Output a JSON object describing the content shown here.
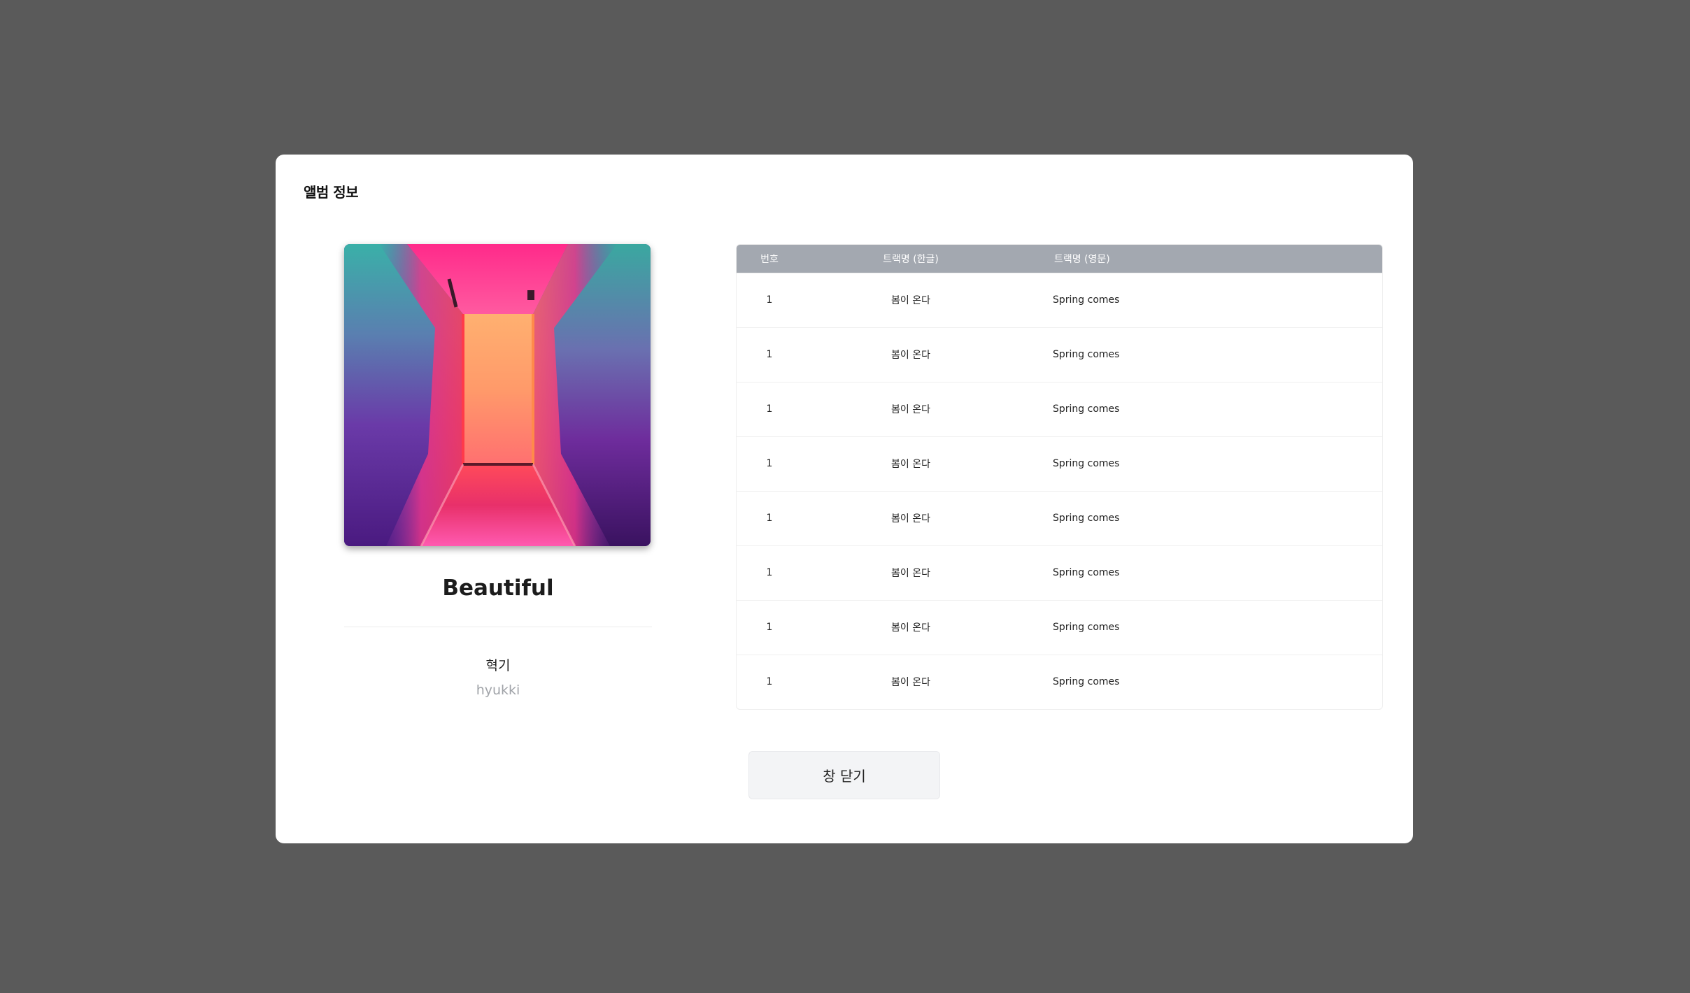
{
  "modal": {
    "title": "앨범 정보"
  },
  "album": {
    "cover_image": "neon-corridor-album-cover",
    "title": "Beautiful",
    "artist_ko": "혁기",
    "artist_en": "hyukki"
  },
  "tracks": {
    "columns": [
      "번호",
      "트랙명 (한글)",
      "트랙명 (영문)"
    ],
    "rows": [
      {
        "no": "1",
        "title_ko": "봄이 온다",
        "title_en": "Spring comes"
      },
      {
        "no": "1",
        "title_ko": "봄이 온다",
        "title_en": "Spring comes"
      },
      {
        "no": "1",
        "title_ko": "봄이 온다",
        "title_en": "Spring comes"
      },
      {
        "no": "1",
        "title_ko": "봄이 온다",
        "title_en": "Spring comes"
      },
      {
        "no": "1",
        "title_ko": "봄이 온다",
        "title_en": "Spring comes"
      },
      {
        "no": "1",
        "title_ko": "봄이 온다",
        "title_en": "Spring comes"
      },
      {
        "no": "1",
        "title_ko": "봄이 온다",
        "title_en": "Spring comes"
      },
      {
        "no": "1",
        "title_ko": "봄이 온다",
        "title_en": "Spring comes"
      }
    ]
  },
  "buttons": {
    "close_label": "창 닫기"
  },
  "colors": {
    "backdrop": "#5a5a5a",
    "table_header": "#a3a8b0",
    "button_bg": "#f3f4f6"
  }
}
